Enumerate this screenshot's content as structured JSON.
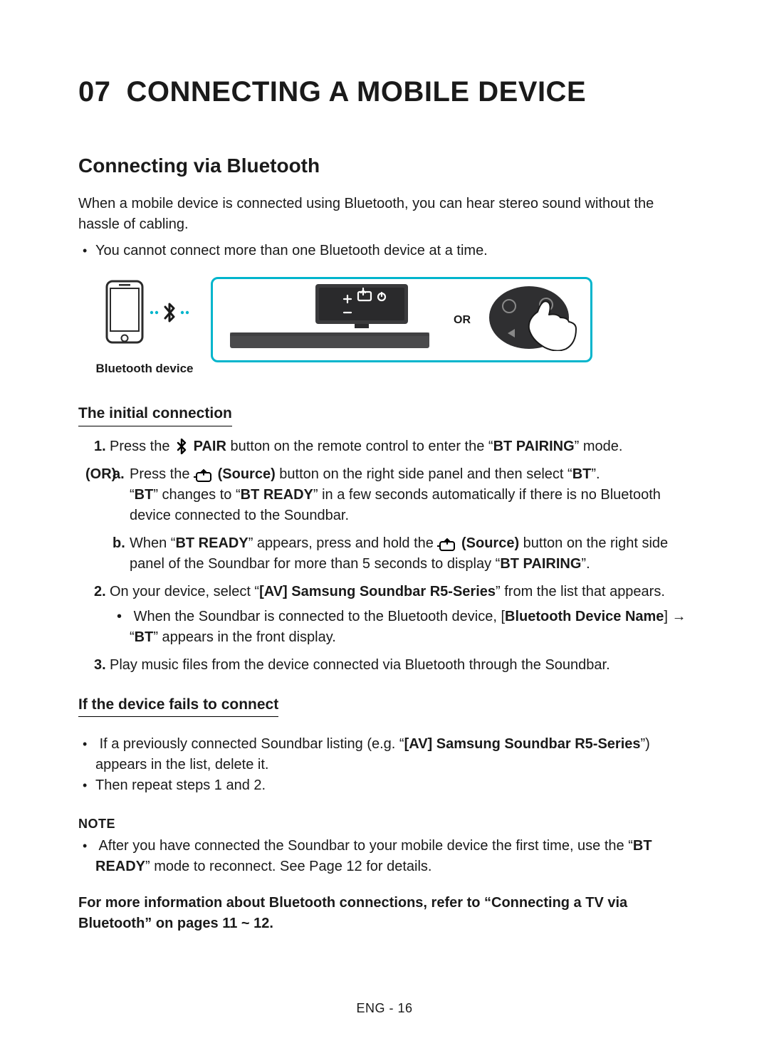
{
  "chapter": {
    "number": "07",
    "title": "CONNECTING A MOBILE DEVICE"
  },
  "section": {
    "title": "Connecting via Bluetooth"
  },
  "intro": "When a mobile device is connected using Bluetooth, you can hear stereo sound without the hassle of cabling.",
  "intro_bullet": "You cannot connect more than one Bluetooth device at a time.",
  "diagram": {
    "phone_label": "Bluetooth device",
    "or": "OR"
  },
  "sub1": {
    "title": "The initial connection",
    "step1_pre": "Press the ",
    "step1_pair": " PAIR",
    "step1_mid": " button on the remote control to enter the “",
    "step1_mode": "BT PAIRING",
    "step1_post": "” mode.",
    "or_label": "(OR)",
    "a_pre": "Press the ",
    "a_src": " (Source)",
    "a_mid": " button on the right side panel and then select “",
    "a_bt": "BT",
    "a_post": "”.",
    "a_line2_pre": "“",
    "a_line2_bt": "BT",
    "a_line2_mid": "” changes to “",
    "a_line2_ready": "BT READY",
    "a_line2_post": "” in a few seconds automatically if there is no Bluetooth device connected to the Soundbar.",
    "b_pre": "When “",
    "b_ready": "BT READY",
    "b_mid": "” appears, press and hold the ",
    "b_src": " (Source)",
    "b_mid2": " button on the right side panel of the Soundbar for more than 5 seconds to display “",
    "b_pair": "BT PAIRING",
    "b_post": "”.",
    "step2_pre": "On your device, select “",
    "step2_name": "[AV] Samsung Soundbar R5-Series",
    "step2_post": "” from the list that appears.",
    "step2_sub_pre": "When the Soundbar is connected to the Bluetooth device, [",
    "step2_sub_name": "Bluetooth Device Name",
    "step2_sub_mid": "] → “",
    "step2_sub_bt": "BT",
    "step2_sub_post": "” appears in the front display.",
    "step3": "Play music files from the device connected via Bluetooth through the Soundbar."
  },
  "sub2": {
    "title": "If the device fails to connect",
    "b1_pre": "If a previously connected Soundbar listing (e.g. “",
    "b1_name": "[AV] Samsung Soundbar R5-Series",
    "b1_post": "”) appears in the list, delete it.",
    "b2": "Then repeat steps 1 and 2."
  },
  "note": {
    "label": "NOTE",
    "b1_pre": "After you have connected the Soundbar to your mobile device the first time, use the “",
    "b1_ready": "BT READY",
    "b1_post": "” mode to reconnect. See Page 12 for details."
  },
  "footer_ref": "For more information about Bluetooth connections, refer to “Connecting a TV via Bluetooth” on pages 11 ~ 12.",
  "pagefoot": "ENG - 16"
}
